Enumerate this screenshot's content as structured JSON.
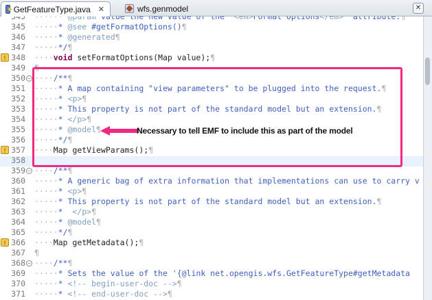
{
  "tabs": [
    {
      "label": "GetFeatureType.java",
      "close": "✕",
      "active": true,
      "icon": "java-file-icon"
    },
    {
      "label": "wfs.genmodel",
      "active": false,
      "icon": "genmodel-file-icon"
    }
  ],
  "window_close": "✕",
  "highlight_color": "#ee2a83",
  "callout": {
    "text": "Necessary to tell EMF to include this as part of the model"
  },
  "lines": [
    {
      "num": "345",
      "text": "     * @param value the new value of the '<em>Format Options</em>' attribute.¶"
    },
    {
      "num": "345",
      "text": "     * @see #getFormatOptions()¶"
    },
    {
      "num": "346",
      "text": "     * @generated¶"
    },
    {
      "num": "347",
      "text": "     */¶"
    },
    {
      "num": "348",
      "text": "    void setFormatOptions(Map value);¶"
    },
    {
      "num": "349",
      "text": "¶"
    },
    {
      "num": "350",
      "text": "    /**¶"
    },
    {
      "num": "351",
      "text": "     * A map containing \"view parameters\" to be plugged into the request.¶"
    },
    {
      "num": "352",
      "text": "     * <p>¶"
    },
    {
      "num": "353",
      "text": "     * This property is not part of the standard model but an extension.¶"
    },
    {
      "num": "354",
      "text": "     * </p>¶"
    },
    {
      "num": "355",
      "text": "     * @model¶"
    },
    {
      "num": "356",
      "text": "     */¶"
    },
    {
      "num": "357",
      "text": "    Map getViewParams();¶"
    },
    {
      "num": "358",
      "text": ""
    },
    {
      "num": "359",
      "text": "    /**¶"
    },
    {
      "num": "360",
      "text": "     * A generic bag of extra information that implementations can use to carry v"
    },
    {
      "num": "361",
      "text": "     * <p>¶"
    },
    {
      "num": "362",
      "text": "     * This property is not part of the standard model but an extension.¶"
    },
    {
      "num": "363",
      "text": "     *  </p>¶"
    },
    {
      "num": "364",
      "text": "     * @model¶"
    },
    {
      "num": "365",
      "text": "     */¶"
    },
    {
      "num": "366",
      "text": "    Map getMetadata();¶"
    },
    {
      "num": "367",
      "text": "¶"
    },
    {
      "num": "368",
      "text": "    /**¶"
    },
    {
      "num": "369",
      "text": "     * Sets the value of the '{@link net.opengis.wfs.GetFeatureType#getMetadata"
    },
    {
      "num": "370",
      "text": "     * <!-- begin-user-doc -->¶"
    },
    {
      "num": "371",
      "text": "     * <!-- end-user-doc -->¶"
    }
  ],
  "gutter_markers": [
    "348",
    "357",
    "366"
  ],
  "fold_markers": [
    "350",
    "359",
    "368"
  ]
}
